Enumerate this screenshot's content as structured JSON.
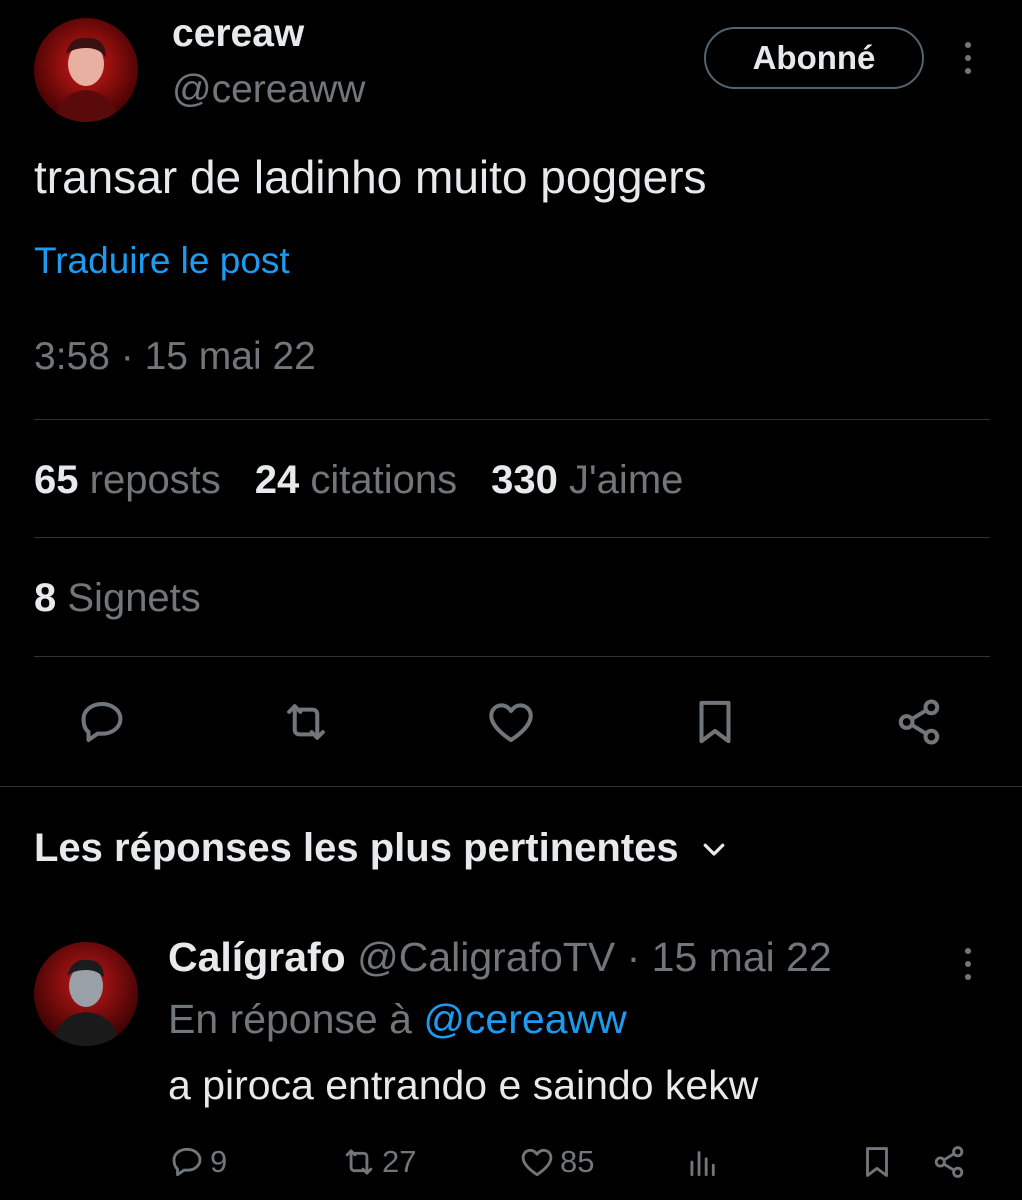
{
  "post": {
    "author_name": "cereaw",
    "author_handle": "@cereaww",
    "follow_label": "Abonné",
    "text": "transar de ladinho muito poggers",
    "translate_label": "Traduire le post",
    "timestamp": "3:58 · 15 mai 22",
    "stats": {
      "reposts_count": "65",
      "reposts_label": "reposts",
      "quotes_count": "24",
      "quotes_label": "citations",
      "likes_count": "330",
      "likes_label": "J'aime",
      "bookmarks_count": "8",
      "bookmarks_label": "Signets"
    },
    "actions": [
      "reply-icon",
      "repost-icon",
      "like-icon",
      "bookmark-icon",
      "share-icon"
    ]
  },
  "replies_section": {
    "title": "Les réponses les plus pertinentes"
  },
  "reply": {
    "author_name": "Calígrafo",
    "author_handle": "@CaligrafoTV",
    "separator": "·",
    "date": "15 mai 22",
    "in_reply_prefix": "En réponse à",
    "in_reply_handle": "@cereaww",
    "text": "a piroca entrando e saindo kekw",
    "replies_count": "9",
    "reposts_count": "27",
    "likes_count": "85"
  },
  "colors": {
    "background": "#000000",
    "text_primary": "#e7e9ea",
    "text_secondary": "#71767b",
    "link": "#1d9bf0",
    "divider": "#2f3336"
  }
}
